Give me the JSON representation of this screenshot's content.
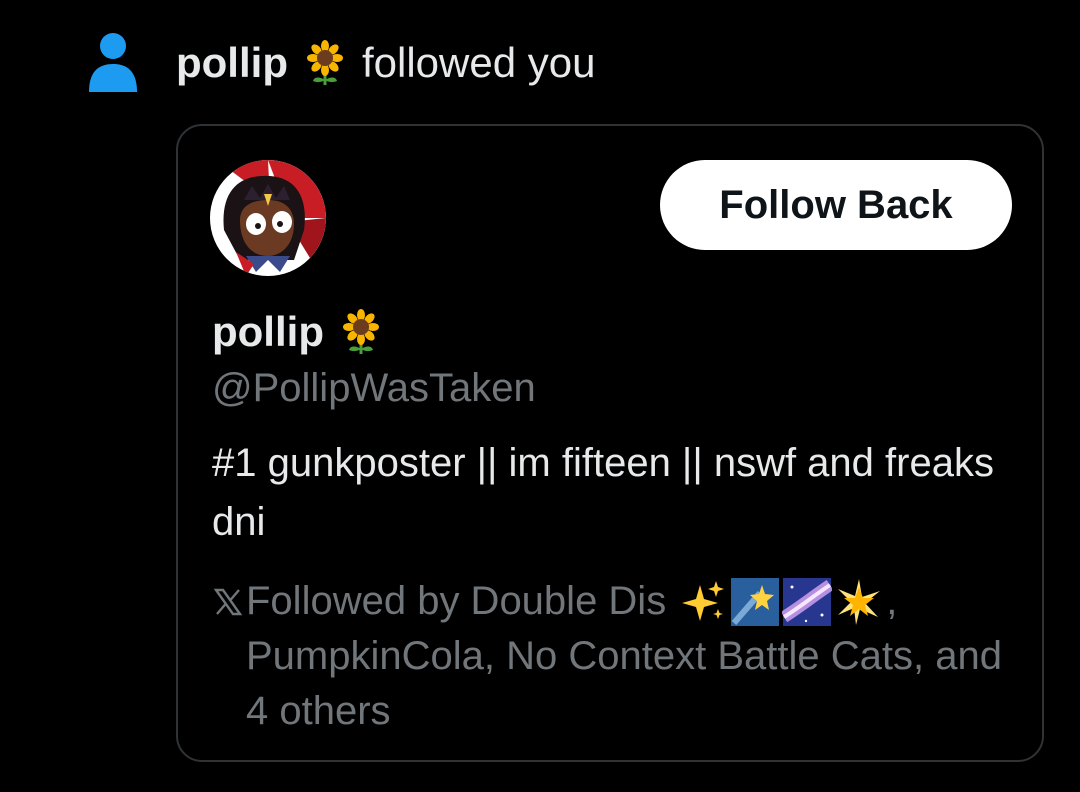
{
  "notification": {
    "user_name": "pollip",
    "name_emoji": "sunflower-emoji",
    "action_text": "followed you",
    "icon": "person-icon",
    "icon_color": "#1d9bf0"
  },
  "profile_card": {
    "avatar": "avatar",
    "follow_button_label": "Follow Back",
    "display_name": "pollip",
    "display_name_emoji": "sunflower-emoji",
    "handle": "@PollipWasTaken",
    "bio": "#1 gunkposter || im fifteen || nswf and freaks dni",
    "followed_by": {
      "icon": "x-logo-icon",
      "prefix": "Followed by Double Dis",
      "emojis": [
        "sparkles-emoji",
        "shooting-star-emoji",
        "milky-way-emoji",
        "glowing-star-emoji"
      ],
      "comma": ",",
      "rest": "PumpkinCola, No Context Battle Cats, and 4 others"
    }
  },
  "colors": {
    "background": "#000000",
    "primary_text": "#e7e9ea",
    "secondary_text": "#71767b",
    "card_border": "#2f3336",
    "button_bg": "#ffffff",
    "button_text": "#0f1419"
  }
}
